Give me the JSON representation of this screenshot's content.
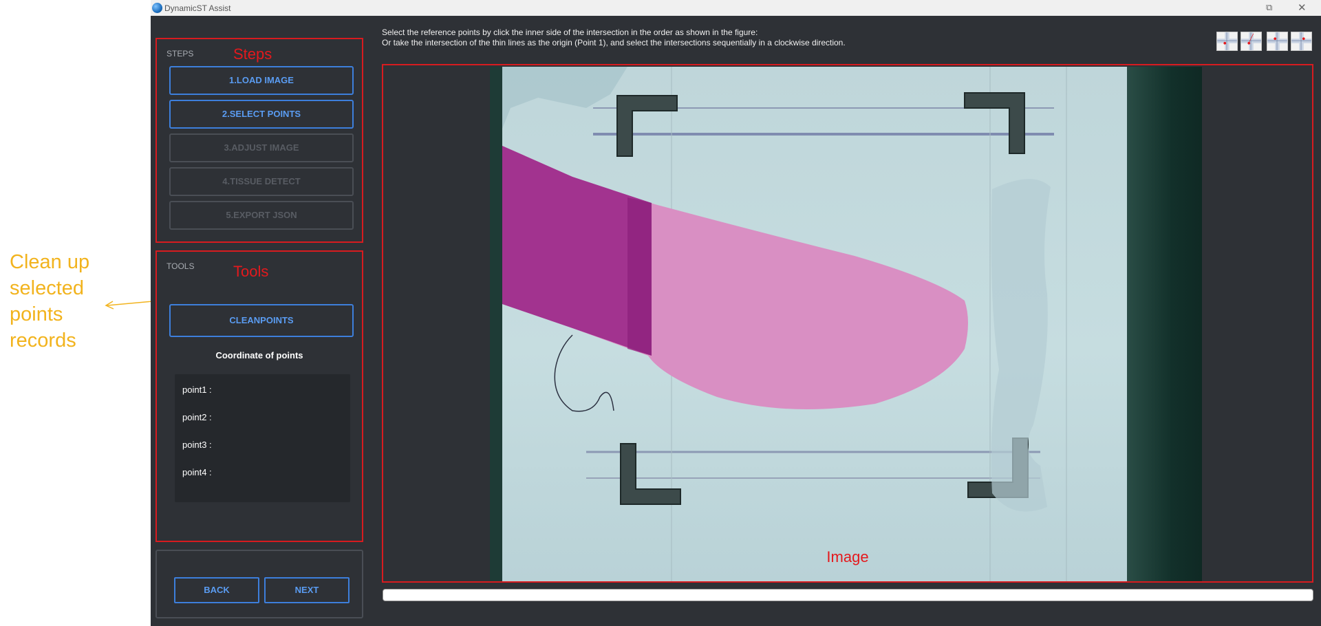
{
  "annotation": {
    "text": "Clean up selected points records",
    "color": "#f2b31d"
  },
  "window": {
    "title": "DynamicST Assist",
    "restore_icon": "restore-icon",
    "close_icon": "close-icon"
  },
  "steps_panel": {
    "caption": "STEPS",
    "tag": "Steps",
    "buttons": [
      {
        "label": "1.LOAD IMAGE",
        "enabled": true
      },
      {
        "label": "2.SELECT POINTS",
        "enabled": true
      },
      {
        "label": "3.ADJUST IMAGE",
        "enabled": false
      },
      {
        "label": "4.TISSUE DETECT",
        "enabled": false
      },
      {
        "label": "5.EXPORT JSON",
        "enabled": false
      }
    ]
  },
  "tools_panel": {
    "caption": "TOOLS",
    "tag": "Tools",
    "clean_button": "CLEANPOINTS",
    "coord_title": "Coordinate of points",
    "points": [
      "point1 :",
      "point2 :",
      "point3 :",
      "point4 :"
    ]
  },
  "nav": {
    "back": "BACK",
    "next": "NEXT"
  },
  "instructions": {
    "line1": "Select the reference points by click the inner side of the intersection in the order as shown in the figure:",
    "line2": "Or take the intersection of the thin lines as the origin (Point 1), and select the intersections sequentially in a clockwise direction."
  },
  "image_area": {
    "tag": "Image"
  },
  "colors": {
    "accent": "#3d7fdc",
    "highlight": "#d81b1f",
    "background": "#2e3136"
  }
}
